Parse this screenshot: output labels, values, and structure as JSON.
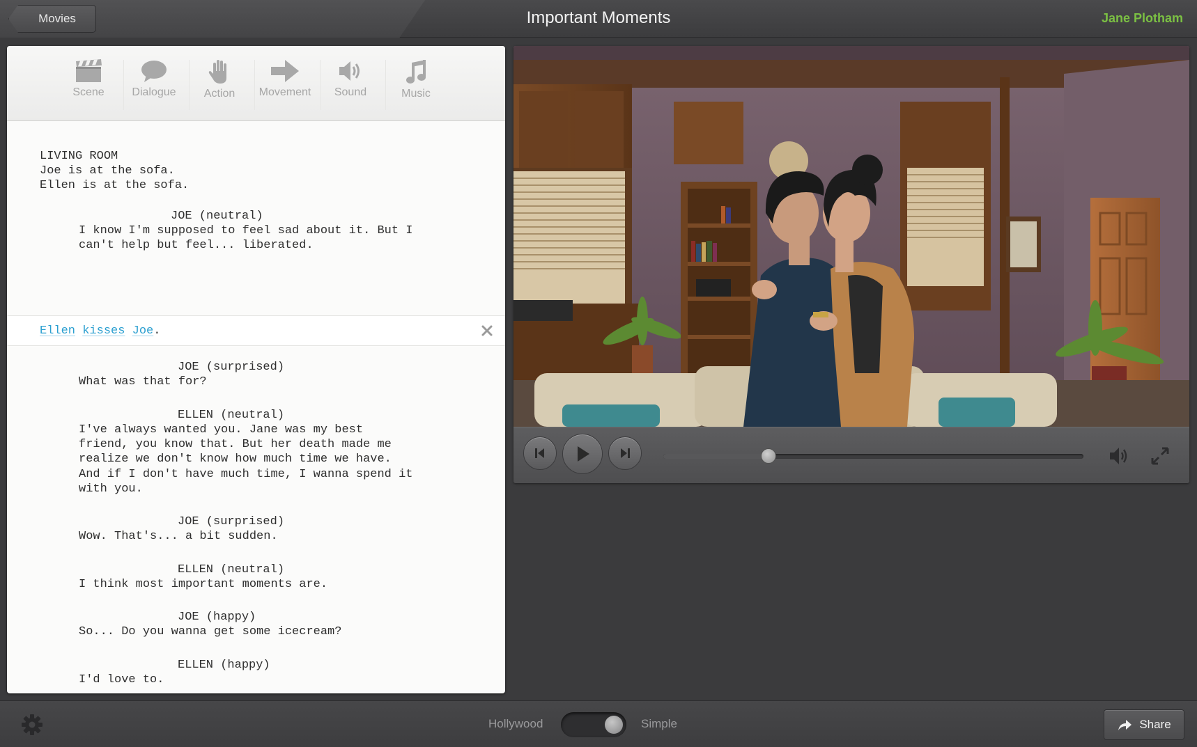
{
  "header": {
    "back_label": "Movies",
    "title": "Important Moments",
    "user": "Jane Plotham"
  },
  "toolbar": {
    "tools": [
      {
        "label": "Scene",
        "icon": "clapperboard-icon"
      },
      {
        "label": "Dialogue",
        "icon": "speech-bubble-icon"
      },
      {
        "label": "Action",
        "icon": "hand-icon"
      },
      {
        "label": "Movement",
        "icon": "arrow-right-icon"
      },
      {
        "label": "Sound",
        "icon": "speaker-icon"
      },
      {
        "label": "Music",
        "icon": "music-note-icon"
      }
    ]
  },
  "script": {
    "scene_heading": "LIVING ROOM",
    "scene_lines": [
      "Joe is at the sofa.",
      "Ellen is at the sofa."
    ],
    "block1": {
      "speaker": "JOE (neutral)",
      "lines": [
        "I know I'm supposed to feel sad about it. But I",
        "can't help but feel... liberated."
      ]
    },
    "action": {
      "subject": "Ellen",
      "verb": "kisses",
      "object": "Joe",
      "end": "."
    },
    "block2": {
      "speaker": "JOE (surprised)",
      "lines": [
        "What was that for?"
      ]
    },
    "block3": {
      "speaker": "ELLEN (neutral)",
      "lines": [
        "I've always wanted you. Jane was my best",
        "friend, you know that. But her death made me",
        "realize we don't know how much time we have.",
        "And if I don't have much time, I wanna spend it",
        "with you."
      ]
    },
    "block4": {
      "speaker": "JOE (surprised)",
      "lines": [
        "Wow. That's... a bit sudden."
      ]
    },
    "block5": {
      "speaker": "ELLEN (neutral)",
      "lines": [
        "I think most important moments are."
      ]
    },
    "block6": {
      "speaker": "JOE (happy)",
      "lines": [
        "So... Do you wanna get some icecream?"
      ]
    },
    "block7": {
      "speaker": "ELLEN (happy)",
      "lines": [
        "I'd love to."
      ]
    }
  },
  "player": {
    "progress": 0.25
  },
  "footer": {
    "mode_left": "Hollywood",
    "mode_right": "Simple",
    "mode_selected": "Simple",
    "share_label": "Share"
  },
  "colors": {
    "accent_green": "#7bc043",
    "link_blue": "#2b9fd0"
  }
}
